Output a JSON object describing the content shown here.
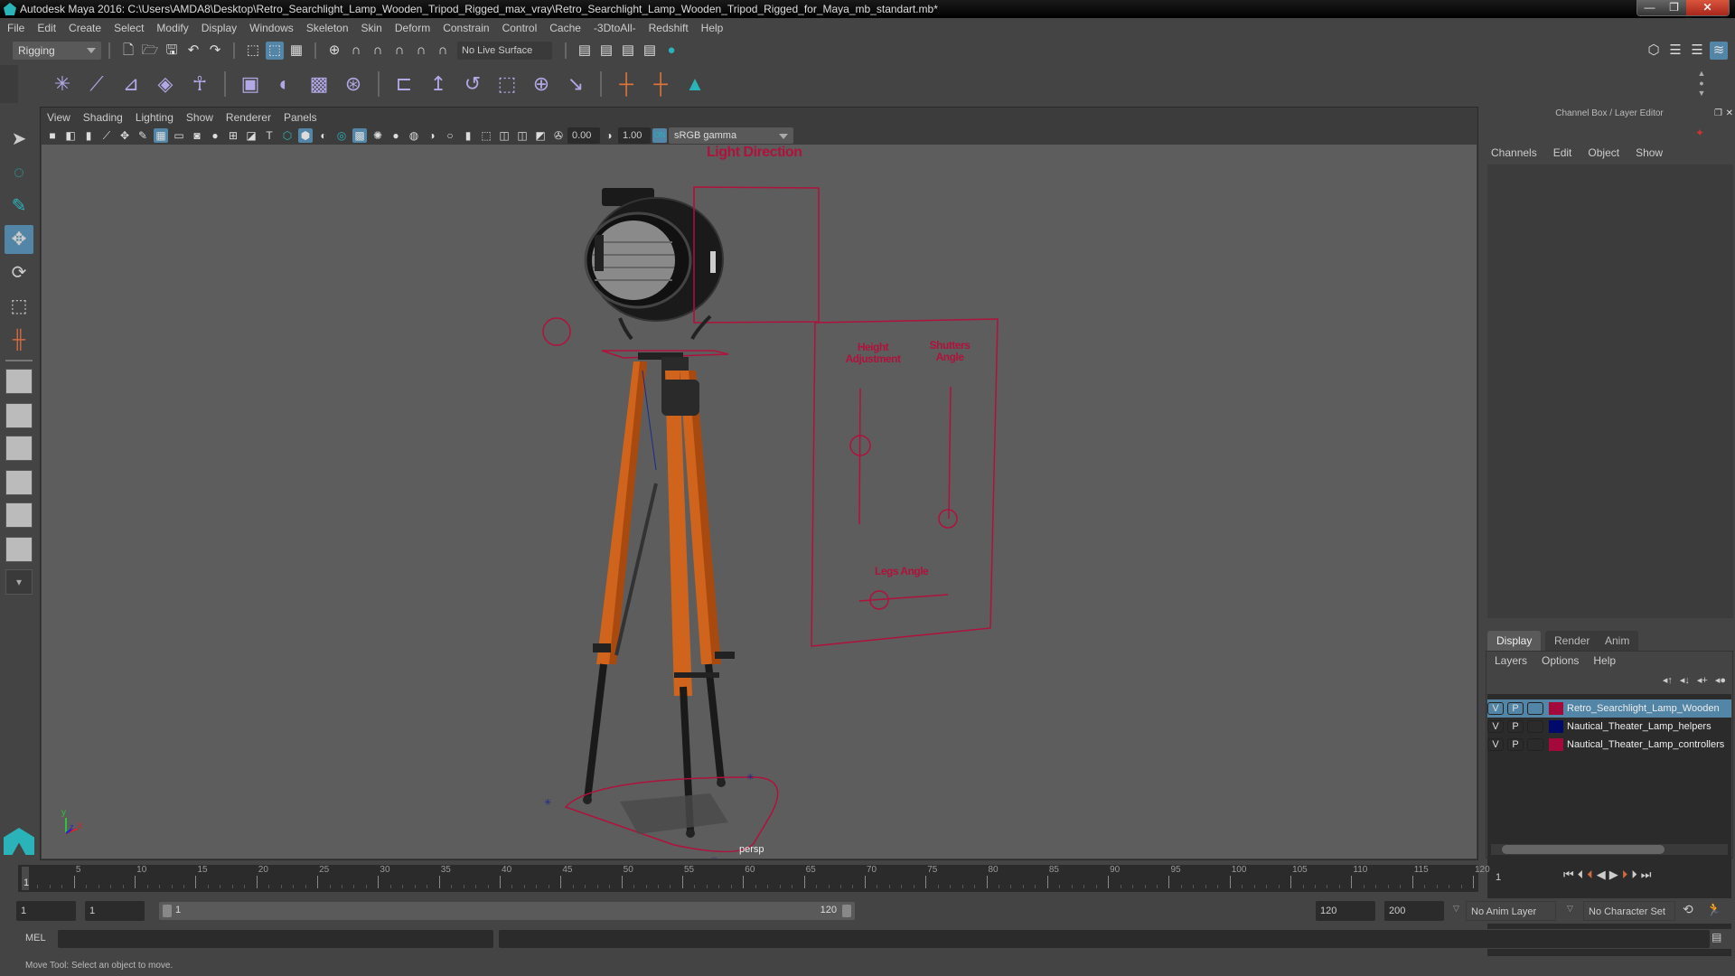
{
  "window": {
    "title": "Autodesk Maya 2016: C:\\Users\\AMDA8\\Desktop\\Retro_Searchlight_Lamp_Wooden_Tripod_Rigged_max_vray\\Retro_Searchlight_Lamp_Wooden_Tripod_Rigged_for_Maya_mb_standart.mb*",
    "buttons": {
      "minimize": "—",
      "restore": "❐",
      "close": "✕"
    }
  },
  "menubar": [
    "File",
    "Edit",
    "Create",
    "Select",
    "Modify",
    "Display",
    "Windows",
    "Skeleton",
    "Skin",
    "Deform",
    "Constrain",
    "Control",
    "Cache",
    "-3DtoAll-",
    "Redshift",
    "Help"
  ],
  "status_line": {
    "menu_set": "Rigging",
    "live_surface": "No Live Surface"
  },
  "panel": {
    "menus": [
      "View",
      "Shading",
      "Lighting",
      "Show",
      "Renderer",
      "Panels"
    ],
    "exposure": "0.00",
    "gamma": "1.00",
    "color_mgmt_toggle": "ON",
    "color_space": "sRGB gamma",
    "camera_label": "persp"
  },
  "scene": {
    "annotations": {
      "light_direction": "Light Direction",
      "height_adjustment_line1": "Height",
      "height_adjustment_line2": "Adjustment",
      "shutters_angle_line1": "Shutters",
      "shutters_angle_line2": "Angle",
      "legs_angle": "Legs Angle"
    },
    "controller_color": "#b0123c",
    "wood_color": "#d0641c"
  },
  "channel_box": {
    "title": "Channel Box / Layer Editor",
    "menus": [
      "Channels",
      "Edit",
      "Object",
      "Show"
    ]
  },
  "layer_editor": {
    "tabs": [
      "Display",
      "Render",
      "Anim"
    ],
    "active_tab": "Display",
    "menus": [
      "Layers",
      "Options",
      "Help"
    ],
    "layers": [
      {
        "v": "V",
        "p": "P",
        "color": "#a3093a",
        "name": "Retro_Searchlight_Lamp_Wooden",
        "selected": true
      },
      {
        "v": "V",
        "p": "P",
        "color": "#000a6b",
        "name": "Nautical_Theater_Lamp_helpers",
        "selected": false
      },
      {
        "v": "V",
        "p": "P",
        "color": "#a3093a",
        "name": "Nautical_Theater_Lamp_controllers",
        "selected": false
      }
    ]
  },
  "timeline": {
    "ticks": [
      "5",
      "10",
      "15",
      "20",
      "25",
      "30",
      "35",
      "40",
      "45",
      "50",
      "55",
      "60",
      "65",
      "70",
      "75",
      "80",
      "85",
      "90",
      "95",
      "100",
      "105",
      "110",
      "115",
      "120"
    ],
    "current_frame_marker": "1",
    "current_frame": "1"
  },
  "range": {
    "start": "1",
    "playback_start": "1",
    "slider_start": "1",
    "slider_end": "120",
    "playback_end": "120",
    "end": "200",
    "anim_layer": "No Anim Layer",
    "character_set": "No Character Set"
  },
  "command_line": {
    "lang": "MEL",
    "value": ""
  },
  "help_line": "Move Tool: Select an object to move."
}
